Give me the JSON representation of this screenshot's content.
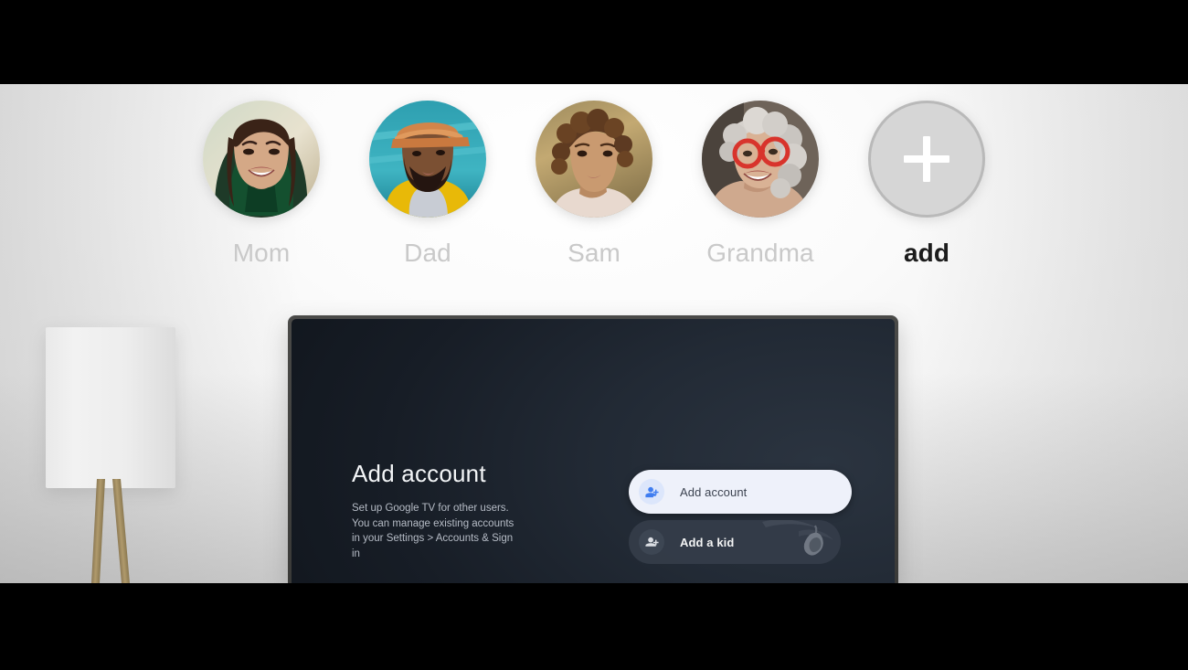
{
  "screen_type": "google-tv-profile-picker",
  "profiles": {
    "items": [
      {
        "name": "Mom",
        "avatar": "photo-woman-smiling",
        "type": "photo"
      },
      {
        "name": "Dad",
        "avatar": "photo-man-cap",
        "type": "photo"
      },
      {
        "name": "Sam",
        "avatar": "photo-child-curly",
        "type": "photo"
      },
      {
        "name": "Grandma",
        "avatar": "photo-older-woman-red-glasses",
        "type": "photo"
      },
      {
        "name": "add",
        "avatar": "plus-icon",
        "type": "add"
      }
    ]
  },
  "tv": {
    "title": "Add account",
    "description": "Set up Google TV for other users. You can manage existing accounts in your Settings > Accounts & Sign in",
    "menu": [
      {
        "label": "Add account",
        "icon": "person-add-icon",
        "selected": true
      },
      {
        "label": "Add a kid",
        "icon": "person-add-icon",
        "selected": false
      }
    ]
  },
  "room": {
    "lamp": "floor-lamp"
  },
  "colors": {
    "accent_blue": "#4285f4",
    "selected_bg": "#eef1fa",
    "rest_bg": "#343c49",
    "screen_bg": "#151b24",
    "bezel": "#3f3f3d",
    "name_text": "#c9c9c9",
    "add_text": "#1c1c1c"
  }
}
